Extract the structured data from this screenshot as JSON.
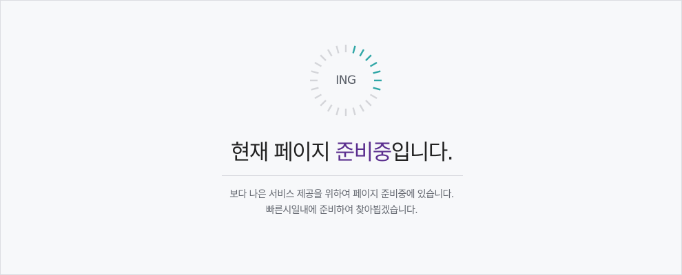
{
  "spinner": {
    "label": "ING",
    "active_color": "#2fa6a6",
    "inactive_color": "#d4d5d9"
  },
  "notice": {
    "title_before": "현재 페이지 ",
    "title_accent": "준비중",
    "title_after": "입니다.",
    "accent_color": "#5b2f8f",
    "line1": "보다 나은 서비스 제공을 위하여 페이지 준비중에 있습니다.",
    "line2": "빠른시일내에 준비하여 찾아뵙겠습니다."
  }
}
